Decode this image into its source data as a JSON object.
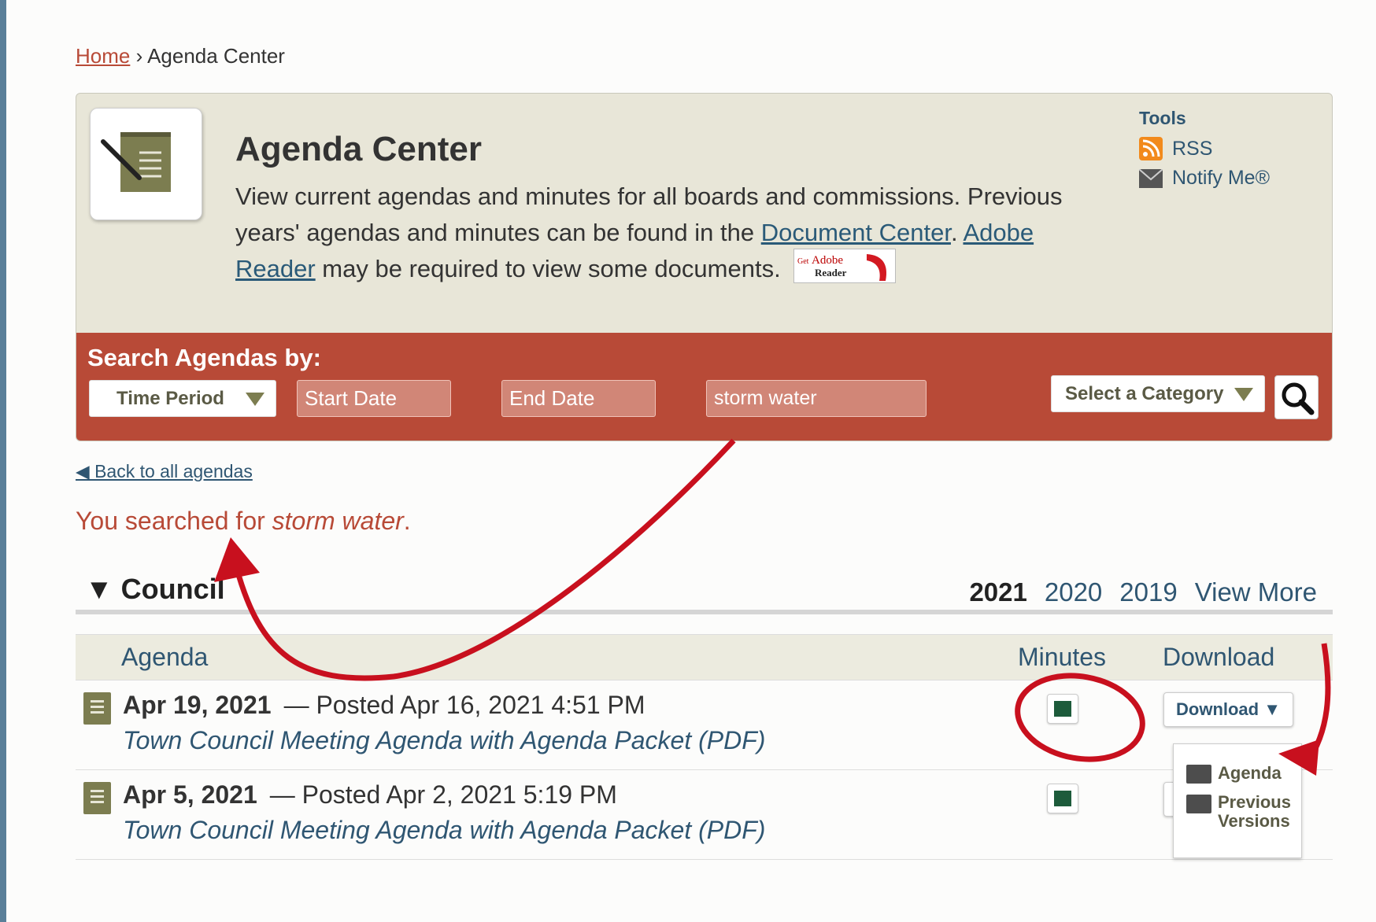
{
  "breadcrumb": {
    "home": "Home",
    "separator": "›",
    "current": "Agenda Center"
  },
  "header": {
    "title": "Agenda Center",
    "intro_1": "View current agendas and minutes for all boards and commissions. Previous years' agendas and minutes can be found in the ",
    "doc_center": "Document Center",
    "intro_2": ". ",
    "adobe_reader": "Adobe Reader",
    "intro_3": " may be required to view some documents.",
    "adobe_badge_get": "Get",
    "adobe_badge_brand": "Adobe",
    "adobe_badge_reader": "Reader"
  },
  "tools": {
    "title": "Tools",
    "rss": "RSS",
    "notify": "Notify Me®"
  },
  "search": {
    "title": "Search Agendas by:",
    "time_period": "Time Period",
    "start_date": "Start Date",
    "end_date": "End Date",
    "keyword_value": "storm water",
    "category": "Select a Category"
  },
  "back_link": "◀ Back to all agendas",
  "searched": {
    "prefix": "You searched for ",
    "term": "storm water",
    "suffix": "."
  },
  "council": {
    "title": "▼ Council",
    "years": [
      "2021",
      "2020",
      "2019"
    ],
    "view_more": "View More"
  },
  "table": {
    "col_agenda": "Agenda",
    "col_minutes": "Minutes",
    "col_download": "Download",
    "rows": [
      {
        "date": "Apr 19, 2021",
        "posted": "— Posted Apr 16, 2021 4:51 PM",
        "title": "Town Council Meeting Agenda with Agenda Packet (PDF)"
      },
      {
        "date": "Apr 5, 2021",
        "posted": "— Posted Apr 2, 2021 5:19 PM",
        "title": "Town Council Meeting Agenda with Agenda Packet (PDF)"
      }
    ],
    "download_label": "Download ▼"
  },
  "dropdown": {
    "agenda": "Agenda",
    "previous": "Previous",
    "versions": "Versions"
  },
  "colors": {
    "accent_red": "#b84a37",
    "link_blue": "#2f5672",
    "panel_bg": "#e8e6d8",
    "annotation_red": "#c8101e"
  }
}
